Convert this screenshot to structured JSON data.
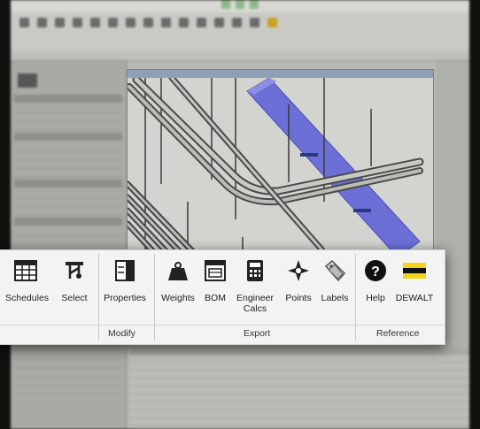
{
  "background_app": {
    "title_tabs": [
      "",
      "",
      ""
    ]
  },
  "ribbon": {
    "panels": [
      {
        "label": ""
      },
      {
        "label": "Modify"
      },
      {
        "label": "Export"
      },
      {
        "label": "Reference"
      }
    ],
    "tools": {
      "schedules": "Schedules",
      "select": "Select",
      "properties": "Properties",
      "weights": "Weights",
      "bom": "BOM",
      "engineer_calcs": "Engineer Calcs",
      "points": "Points",
      "labels": "Labels",
      "help": "Help",
      "dewalt": "DEWALT"
    }
  },
  "colors": {
    "ribbon_bg": "#f3f3f3",
    "dewalt_yellow": "#f2d41a",
    "duct_blue": "#6c6fd6"
  }
}
